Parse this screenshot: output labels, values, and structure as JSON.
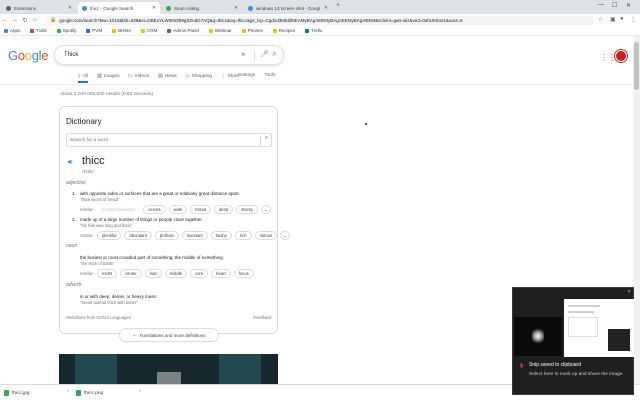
{
  "browser": {
    "tabs": [
      {
        "title": "Extensions",
        "favicon_color": "#5f6368",
        "active": false
      },
      {
        "title": "thicc - Google Search",
        "favicon_color": "#4285f4",
        "active": true
      },
      {
        "title": "Store Listing",
        "favicon_color": "#34a853",
        "active": false
      },
      {
        "title": "windows 10 screen shot - Googl",
        "favicon_color": "#4285f4",
        "active": false
      }
    ],
    "new_tab": "+",
    "url": "google.com/search?biw=1010&bih=638&ei=DBEuYLW0I5OB9gSZndG7AQ&q=thicc&oq=thicc&gs_lcp=Cgdnd3Mtd2l6EAMyBAgAEEMyBAgAEEMyBAgAEEM&sclient=gws-wiz&ved=0ahUKEwi1&uact=5",
    "bookmarks": [
      {
        "label": "Apps",
        "color": "#4285f4"
      },
      {
        "label": "Tickit",
        "color": "#e53935"
      },
      {
        "label": "Spotify",
        "color": "#1db954"
      },
      {
        "label": "PVM",
        "color": "#1a73e8"
      },
      {
        "label": "BHMA",
        "color": "#fbbc04"
      },
      {
        "label": "CRM",
        "color": "#fbbc04"
      },
      {
        "label": "Admin Panel",
        "color": "#5f6368"
      },
      {
        "label": "Webinar",
        "color": "#fbbc04"
      },
      {
        "label": "Phones",
        "color": "#fbbc04"
      },
      {
        "label": "Recipes",
        "color": "#fbbc04"
      },
      {
        "label": "Trello",
        "color": "#0079bf"
      }
    ]
  },
  "search": {
    "logo": "Google",
    "query": "Thick",
    "filters": [
      {
        "label": "All",
        "icon": "search-icon",
        "active": true
      },
      {
        "label": "Images",
        "icon": "image-icon",
        "active": false
      },
      {
        "label": "Videos",
        "icon": "video-icon",
        "active": false
      },
      {
        "label": "News",
        "icon": "news-icon",
        "active": false
      },
      {
        "label": "Shopping",
        "icon": "tag-icon",
        "active": false
      },
      {
        "label": "More",
        "icon": "more-icon",
        "active": false
      }
    ],
    "tools": [
      "Settings",
      "Tools"
    ],
    "stats": "About 1,040,000,000 results (0.53 seconds)"
  },
  "dictionary": {
    "title": "Dictionary",
    "search_placeholder": "Search for a word",
    "word": "thicc",
    "pronunciation": "/THik/",
    "adjective_label": "adjective",
    "noun_label": "noun",
    "adverb_label": "adverb",
    "definitions": [
      {
        "num": "1.",
        "text": "with opposite sides or surfaces that are a great or relatively great distance apart.",
        "example": "\"thick slices of bread\"",
        "similar_label": "Similar:",
        "similar": [
          "in extent/diameter",
          "across",
          "wide",
          "broad",
          "deep",
          "stocky"
        ]
      },
      {
        "num": "2.",
        "text": "made up of a large number of things or people close together.",
        "example": "\"his hair was long and thick\"",
        "similar_label": "Similar:",
        "similar": [
          "plentiful",
          "abundant",
          "profuse",
          "luxuriant",
          "bushy",
          "rich",
          "riotous"
        ]
      }
    ],
    "noun_def": {
      "text": "the busiest or most crowded part of something; the middle of something.",
      "example": "\"the thick of battle\"",
      "similar_label": "Similar:",
      "similar": [
        "midst",
        "center",
        "hub",
        "middle",
        "core",
        "heart",
        "focus"
      ]
    },
    "adverb_def": {
      "text": "in or with deep, dense, or heavy mass.",
      "example": "\"bread spread thick with butter\""
    },
    "source": "Definitions from Oxford Languages",
    "feedback": "Feedback",
    "more_button": "Translations and more definitions"
  },
  "downloads": [
    {
      "name": "thicc.jpg"
    },
    {
      "name": "thicc.png"
    }
  ],
  "toast": {
    "title": "Snip saved to clipboard",
    "body": "Select here to mark up and share the image."
  }
}
